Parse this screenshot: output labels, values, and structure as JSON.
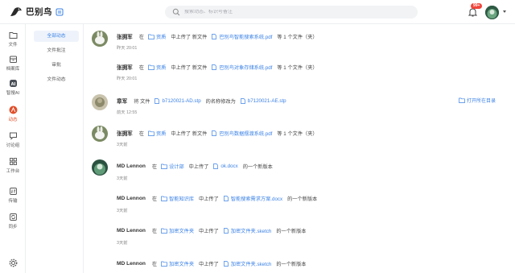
{
  "app": {
    "name": "巴别鸟"
  },
  "search": {
    "placeholder": "搜索动态、标识号备注"
  },
  "notifications": {
    "badge": "99+"
  },
  "rail": [
    {
      "label": "文件",
      "icon": "folder-icon"
    },
    {
      "label": "档案库",
      "icon": "archive-icon"
    },
    {
      "label": "智搜AI",
      "icon": "ai-icon"
    },
    {
      "label": "动态",
      "icon": "activity-icon"
    },
    {
      "label": "讨论组",
      "icon": "chat-icon"
    },
    {
      "label": "工作台",
      "icon": "grid-icon"
    },
    {
      "label": "传输",
      "icon": "transfer-icon"
    },
    {
      "label": "同步",
      "icon": "sync-icon"
    }
  ],
  "subnav": [
    {
      "label": "全部动态",
      "active": true
    },
    {
      "label": "文件批注",
      "active": false
    },
    {
      "label": "审批",
      "active": false
    },
    {
      "label": "文件动态",
      "active": false
    }
  ],
  "feed": [
    {
      "user": "张拥军",
      "in": "在",
      "folder": "资质",
      "action": "中上传了 新文件",
      "file": "巴别鸟智能搜索系统.pdf",
      "suffix": "等 1 个文件（夹）",
      "time": "昨天 20:01"
    },
    {
      "user": "张拥军",
      "in": "在",
      "folder": "资质",
      "action": "中上传了 新文件",
      "file": "巴别鸟对象存储系统.pdf",
      "suffix": "等 1 个文件（夹）",
      "time": "昨天 20:01"
    },
    {
      "user": "章军",
      "in": "将 文件",
      "folder": "b7120021-AD.stp",
      "action": "的名称修改为",
      "file": "b7120021-AE.stp",
      "suffix": "",
      "time": "前天 12:55",
      "open_dir": "打开所在目录"
    },
    {
      "user": "张拥军",
      "in": "在",
      "folder": "资质",
      "action": "中上传了 新文件",
      "file": "巴别鸟数据摆渡系统.pdf",
      "suffix": "等 1 个文件（夹）",
      "time": "3天前"
    },
    {
      "user": "MD Lennon",
      "in": "在",
      "folder": "设计部",
      "action": "中上传了",
      "file": "ok.docx",
      "suffix": "的一个新版本",
      "time": "3天前"
    },
    {
      "user": "MD Lennon",
      "in": "在",
      "folder": "智能知识库",
      "action": "中上传了",
      "file": "智能搜索需求方案.docx",
      "suffix": "的一个新版本",
      "time": "3天前"
    },
    {
      "user": "MD Lennon",
      "in": "在",
      "folder": "加密文件夹",
      "action": "中上传了",
      "file": "加密文件夹.sketch",
      "suffix": "的一个新版本",
      "time": "3天前"
    },
    {
      "user": "MD Lennon",
      "in": "在",
      "folder": "加密文件夹",
      "action": "中上传了",
      "file": "加密文件夹.sketch",
      "suffix": "的一个新版本",
      "time": ""
    }
  ],
  "colors": {
    "accent": "#3b82e6",
    "active_rail": "#e0502c",
    "badge": "#f0453a"
  }
}
